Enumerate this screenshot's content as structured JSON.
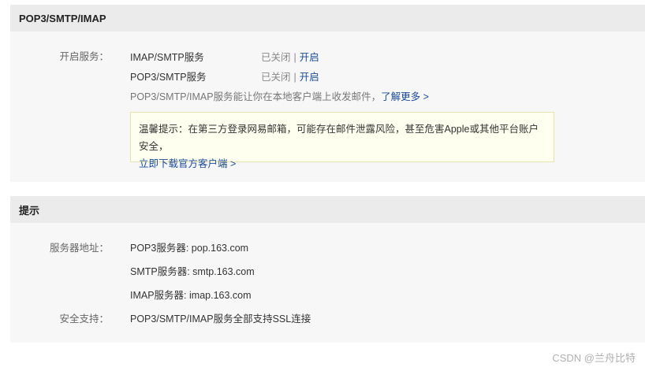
{
  "section1": {
    "title": "POP3/SMTP/IMAP",
    "open_label": "开启服务：",
    "services": [
      {
        "name": "IMAP/SMTP服务",
        "status": "已关闭",
        "sep": "|",
        "action": "开启"
      },
      {
        "name": "POP3/SMTP服务",
        "status": "已关闭",
        "sep": "|",
        "action": "开启"
      }
    ],
    "description": "POP3/SMTP/IMAP服务能让你在本地客户端上收发邮件，",
    "learn_more": "了解更多 >",
    "notice_text": "温馨提示：在第三方登录网易邮箱，可能存在邮件泄露风险，甚至危害Apple或其他平台账户安全，",
    "notice_link": "立即下载官方客户端 >"
  },
  "section2": {
    "title": "提示",
    "server_label": "服务器地址：",
    "servers": [
      "POP3服务器: pop.163.com",
      "SMTP服务器: smtp.163.com",
      "IMAP服务器: imap.163.com"
    ],
    "security_label": "安全支持：",
    "security_value": "POP3/SMTP/IMAP服务全部支持SSL连接"
  },
  "watermark": "CSDN @兰舟比特"
}
